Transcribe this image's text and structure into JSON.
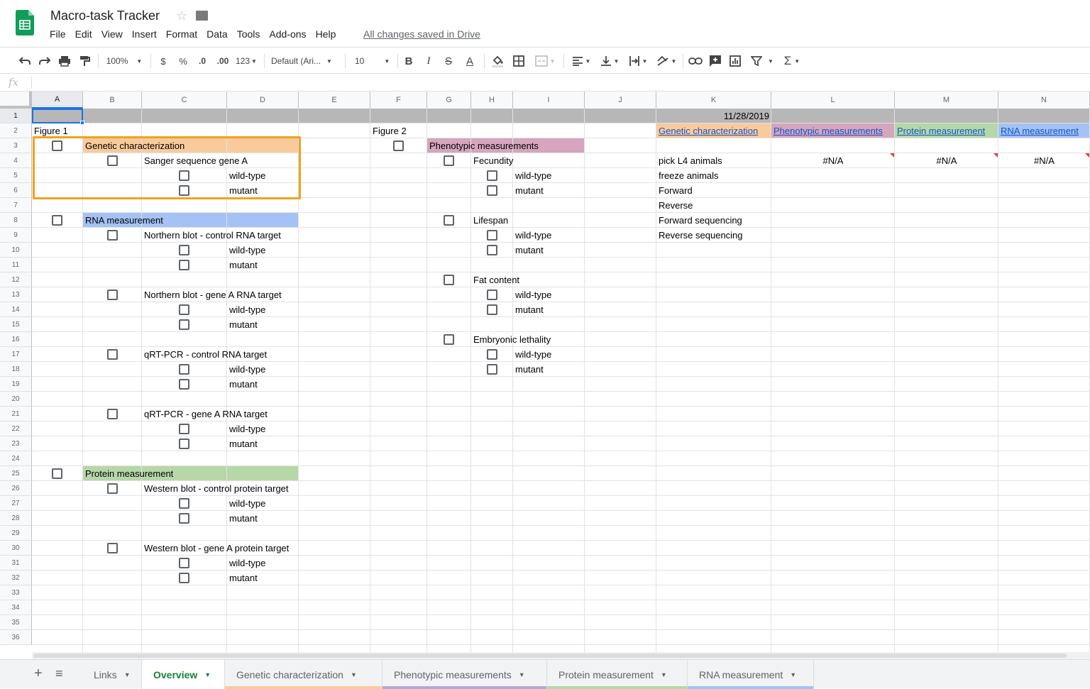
{
  "app": {
    "title": "Macro-task Tracker",
    "star_icon": "star-icon",
    "folder_icon": "folder-icon",
    "saved_status": "All changes saved in Drive",
    "menu": [
      "File",
      "Edit",
      "View",
      "Insert",
      "Format",
      "Data",
      "Tools",
      "Add-ons",
      "Help"
    ]
  },
  "toolbar": {
    "zoom": "100%",
    "currency": "$",
    "percent": "%",
    "dec_decrease": ".0",
    "dec_increase": ".00",
    "number_format": "123",
    "font": "Default (Ari...",
    "font_size": "10",
    "bold": "B",
    "italic": "I",
    "strike": "S",
    "text_color": "A",
    "sum": "Σ"
  },
  "formula_bar": {
    "fx": "fx",
    "value": ""
  },
  "columns": [
    "A",
    "B",
    "C",
    "D",
    "E",
    "F",
    "G",
    "H",
    "I",
    "J",
    "K",
    "L",
    "M",
    "N"
  ],
  "rows": [
    "1",
    "2",
    "3",
    "4",
    "5",
    "6",
    "7",
    "8",
    "9",
    "10",
    "11",
    "12",
    "13",
    "14",
    "15",
    "16",
    "17",
    "18",
    "19",
    "20",
    "21",
    "22",
    "23",
    "24",
    "25",
    "26",
    "27",
    "28",
    "29",
    "30",
    "31",
    "32",
    "33",
    "34",
    "35",
    "36"
  ],
  "colors": {
    "genetic": "#f9cb9c",
    "phenotypic": "#d5a6bd",
    "rna": "#a4c2f4",
    "protein": "#b6d7a8",
    "row1_fill": "#b7b7b7",
    "highlight_box": "#f0a21c",
    "active_tab_text": "#188038",
    "tab_links": "#f1f3f4",
    "tab_genetic": "#f9cb9c",
    "tab_phenotypic": "#b4a7d6",
    "tab_protein": "#b6d7a8",
    "tab_rna": "#a4c2f4"
  },
  "cells": {
    "date": "11/28/2019",
    "figure1": "Figure 1",
    "figure2": "Figure 2",
    "genetic_header": "Genetic characterization",
    "sanger": "Sanger sequence gene A",
    "rna_header": "RNA measurement",
    "northern_control": "Northern blot - control RNA target",
    "northern_geneA": "Northern blot - gene A RNA target",
    "qrt_control": "qRT-PCR - control RNA target",
    "qrt_geneA": "qRT-PCR - gene A RNA target",
    "protein_header": "Protein measurement",
    "western_control": "Western blot - control protein target",
    "western_geneA": "Western blot - gene A protein target",
    "wild_type": "wild-type",
    "mutant": "mutant",
    "phenotypic_header": "Phenotypic measurements",
    "fecundity": "Fecundity",
    "lifespan": "Lifespan",
    "fat_content": "Fat content",
    "embryonic_lethality": "Embryonic lethality",
    "link_genetic": "Genetic characterization",
    "link_phenotypic": "Phenotypic measurements",
    "link_protein": "Protein measurement",
    "link_rna": "RNA measurement",
    "k4": "pick L4 animals",
    "k5": "freeze animals",
    "k6": "Forward",
    "k7": "Reverse",
    "k8": "Forward sequencing",
    "k9": "Reverse sequencing",
    "na": "#N/A"
  },
  "sheet_tabs": [
    {
      "label": "Links",
      "active": false
    },
    {
      "label": "Overview",
      "active": true
    },
    {
      "label": "Genetic characterization",
      "active": false
    },
    {
      "label": "Phenotypic measurements",
      "active": false
    },
    {
      "label": "Protein measurement",
      "active": false
    },
    {
      "label": "RNA measurement",
      "active": false
    }
  ],
  "sheetbar_icons": {
    "add": "+",
    "all_sheets": "≡",
    "caret": "▼"
  }
}
